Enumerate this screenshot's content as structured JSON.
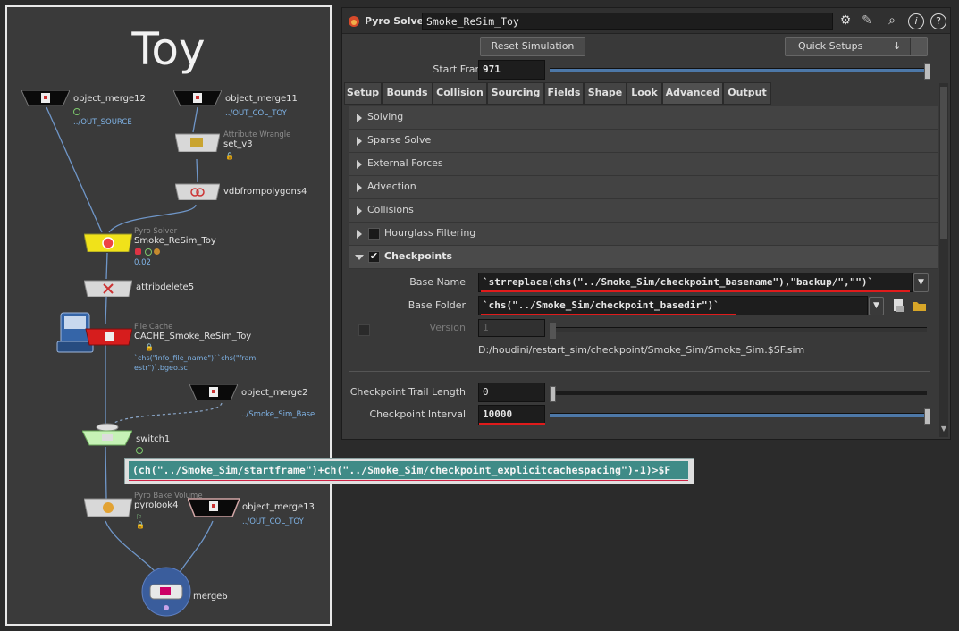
{
  "network": {
    "title": "Toy",
    "nodes": {
      "object_merge12": {
        "label": "object_merge12",
        "sub": "../OUT_SOURCE"
      },
      "object_merge11": {
        "label": "object_merge11",
        "sub": "../OUT_COL_TOY"
      },
      "set_v3": {
        "type": "Attribute Wrangle",
        "label": "set_v3"
      },
      "vdbfrompolygons4": {
        "label": "vdbfrompolygons4"
      },
      "pyro_solver": {
        "type": "Pyro Solver",
        "label": "Smoke_ReSim_Toy",
        "sub": "0.02"
      },
      "attribdelete5": {
        "label": "attribdelete5"
      },
      "file_cache": {
        "type": "File Cache",
        "label": "CACHE_Smoke_ReSim_Toy",
        "sub_line1": "`chs(\"info_file_name\")``chs(\"fram",
        "sub_line2": "estr\")`.bgeo.sc"
      },
      "object_merge2": {
        "label": "object_merge2",
        "sub": "../Smoke_Sim_Base"
      },
      "switch1": {
        "label": "switch1"
      },
      "pyrolook4": {
        "type": "Pyro Bake Volume",
        "label": "pyrolook4"
      },
      "object_merge13": {
        "label": "object_merge13",
        "sub": "../OUT_COL_TOY"
      },
      "merge6": {
        "label": "merge6"
      }
    }
  },
  "expression_popup": {
    "text": "(ch(\"../Smoke_Sim/startframe\")+ch(\"../Smoke_Sim/checkpoint_explicitcachespacing\")-1)>$F"
  },
  "params": {
    "header": {
      "node_type": "Pyro Solver",
      "node_name": "Smoke_ReSim_Toy",
      "icons": [
        "gear-icon",
        "brush-icon",
        "search-icon",
        "info-icon",
        "help-icon"
      ]
    },
    "reset_button": "Reset Simulation",
    "quick_setups": {
      "label": "Quick Setups",
      "arrow": "↓"
    },
    "start_frame": {
      "label": "Start Frame",
      "value": "971"
    },
    "tabs": [
      "Setup",
      "Bounds",
      "Collision",
      "Sourcing",
      "Fields",
      "Shape",
      "Look",
      "Advanced",
      "Output"
    ],
    "active_tab": "Advanced",
    "sections": [
      "Solving",
      "Sparse Solve",
      "External Forces",
      "Advection",
      "Collisions",
      "Hourglass Filtering",
      "Checkpoints"
    ],
    "checkpoints": {
      "base_name": {
        "label": "Base Name",
        "value": "`strreplace(chs(\"../Smoke_Sim/checkpoint_basename\"),\"backup/\",\"\")`"
      },
      "base_folder": {
        "label": "Base Folder",
        "value": "`chs(\"../Smoke_Sim/checkpoint_basedir\")`"
      },
      "version": {
        "label": "Version",
        "value": "1"
      },
      "resolved_path": "D:/houdini/restart_sim/checkpoint/Smoke_Sim/Smoke_Sim.$SF.sim",
      "trail_length": {
        "label": "Checkpoint Trail Length",
        "value": "0"
      },
      "interval": {
        "label": "Checkpoint Interval",
        "value": "10000"
      }
    },
    "colors": {
      "accent_red": "#e01b1b",
      "slider_blue": "#4d78a8",
      "expr_teal": "#3f8b87"
    }
  }
}
